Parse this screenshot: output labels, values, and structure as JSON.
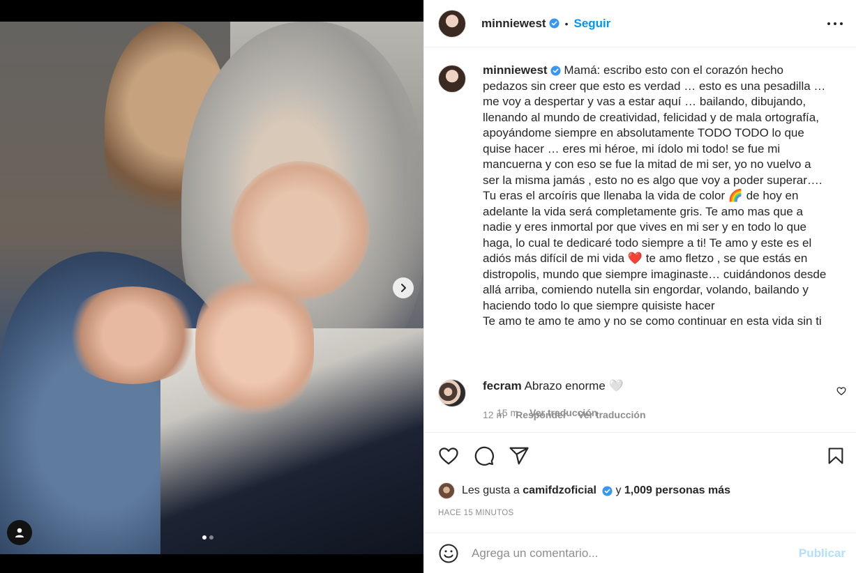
{
  "post": {
    "author": "minniewest",
    "follow_label": "Seguir",
    "separator": "•",
    "caption_lines": [
      "Mamá: escribo esto con el corazón hecho",
      "pedazos sin creer que esto es verdad … esto es una pesadilla …",
      "me voy a despertar y vas a estar aquí … bailando, dibujando,",
      "llenando al mundo de creatividad, felicidad y de mala ortografía,",
      "apoyándome siempre en absolutamente TODO TODO lo que",
      "quise hacer … eres mi héroe, mi ídolo mi todo! se fue mi",
      "mancuerna y con eso se fue la mitad de mi ser, yo no vuelvo a",
      "ser la misma jamás , esto no es algo que voy a poder superar….",
      "Tu eras el arcoíris que llenaba la vida de color 🌈 de hoy en",
      "adelante la vida será completamente gris. Te amo mas que a",
      "nadie y eres inmortal por que vives en mi ser y en todo lo que",
      "haga, lo cual te dedicaré todo siempre a ti! Te amo y este es el",
      "adiós más difícil de mi vida ❤️ te amo fletzo , se que estás en",
      "distropolis, mundo que siempre imaginaste… cuidándonos desde",
      "allá arriba, comiendo nutella sin engordar, volando, bailando y",
      "haciendo todo lo que siempre quisiste hacer",
      "Te amo te amo te amo y no se como continuar en esta vida sin ti"
    ],
    "caption_time": "15 m",
    "translate_label": "Ver traducción"
  },
  "comment": {
    "author": "fecram",
    "text": "Abrazo enorme",
    "emoji": "🤍",
    "time": "12 m",
    "reply_label": "Responder",
    "translate_label": "Ver traducción"
  },
  "likes": {
    "prefix": "Les gusta a",
    "user": "camifdzoficial",
    "connector": "y",
    "others": "1,009 personas más"
  },
  "timestamp": "HACE 15 MINUTOS",
  "add_comment": {
    "placeholder": "Agrega un comentario...",
    "publish_label": "Publicar"
  },
  "carousel": {
    "count": 2,
    "active": 1
  },
  "colors": {
    "accent": "#0095f6",
    "verified": "#3897f0",
    "heart_like": "#262626",
    "publish_disabled": "#b2dffc"
  },
  "icons": [
    "chevron-right-icon",
    "user-tag-icon",
    "verified-badge-icon",
    "more-icon",
    "heart-icon",
    "comment-icon",
    "share-icon",
    "bookmark-icon",
    "emoji-icon"
  ]
}
